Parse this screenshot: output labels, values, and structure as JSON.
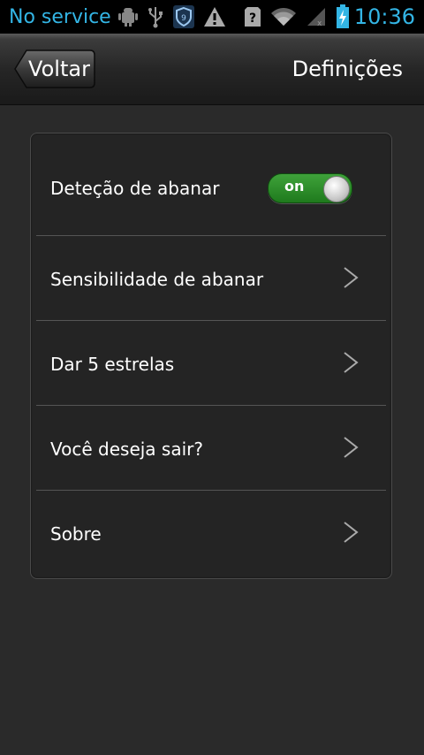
{
  "status_bar": {
    "carrier": "No service",
    "time": "10:36",
    "icons": [
      "android-debug-icon",
      "usb-icon",
      "shield-app-icon",
      "warning-icon",
      "unknown-sim-icon",
      "wifi-icon",
      "signal-icon",
      "battery-charging-icon"
    ]
  },
  "header": {
    "back_label": "Voltar",
    "title": "Definições"
  },
  "settings": {
    "shake_detection": {
      "label": "Deteção de abanar",
      "toggle_label": "on",
      "enabled": true
    },
    "items": [
      {
        "label": "Sensibilidade de abanar"
      },
      {
        "label": "Dar 5 estrelas"
      },
      {
        "label": "Você deseja sair?"
      },
      {
        "label": "Sobre"
      }
    ]
  },
  "colors": {
    "status_text": "#33b5e5",
    "background": "#2a2a2a",
    "card": "#242424",
    "toggle_on": "#2e8f2b"
  }
}
